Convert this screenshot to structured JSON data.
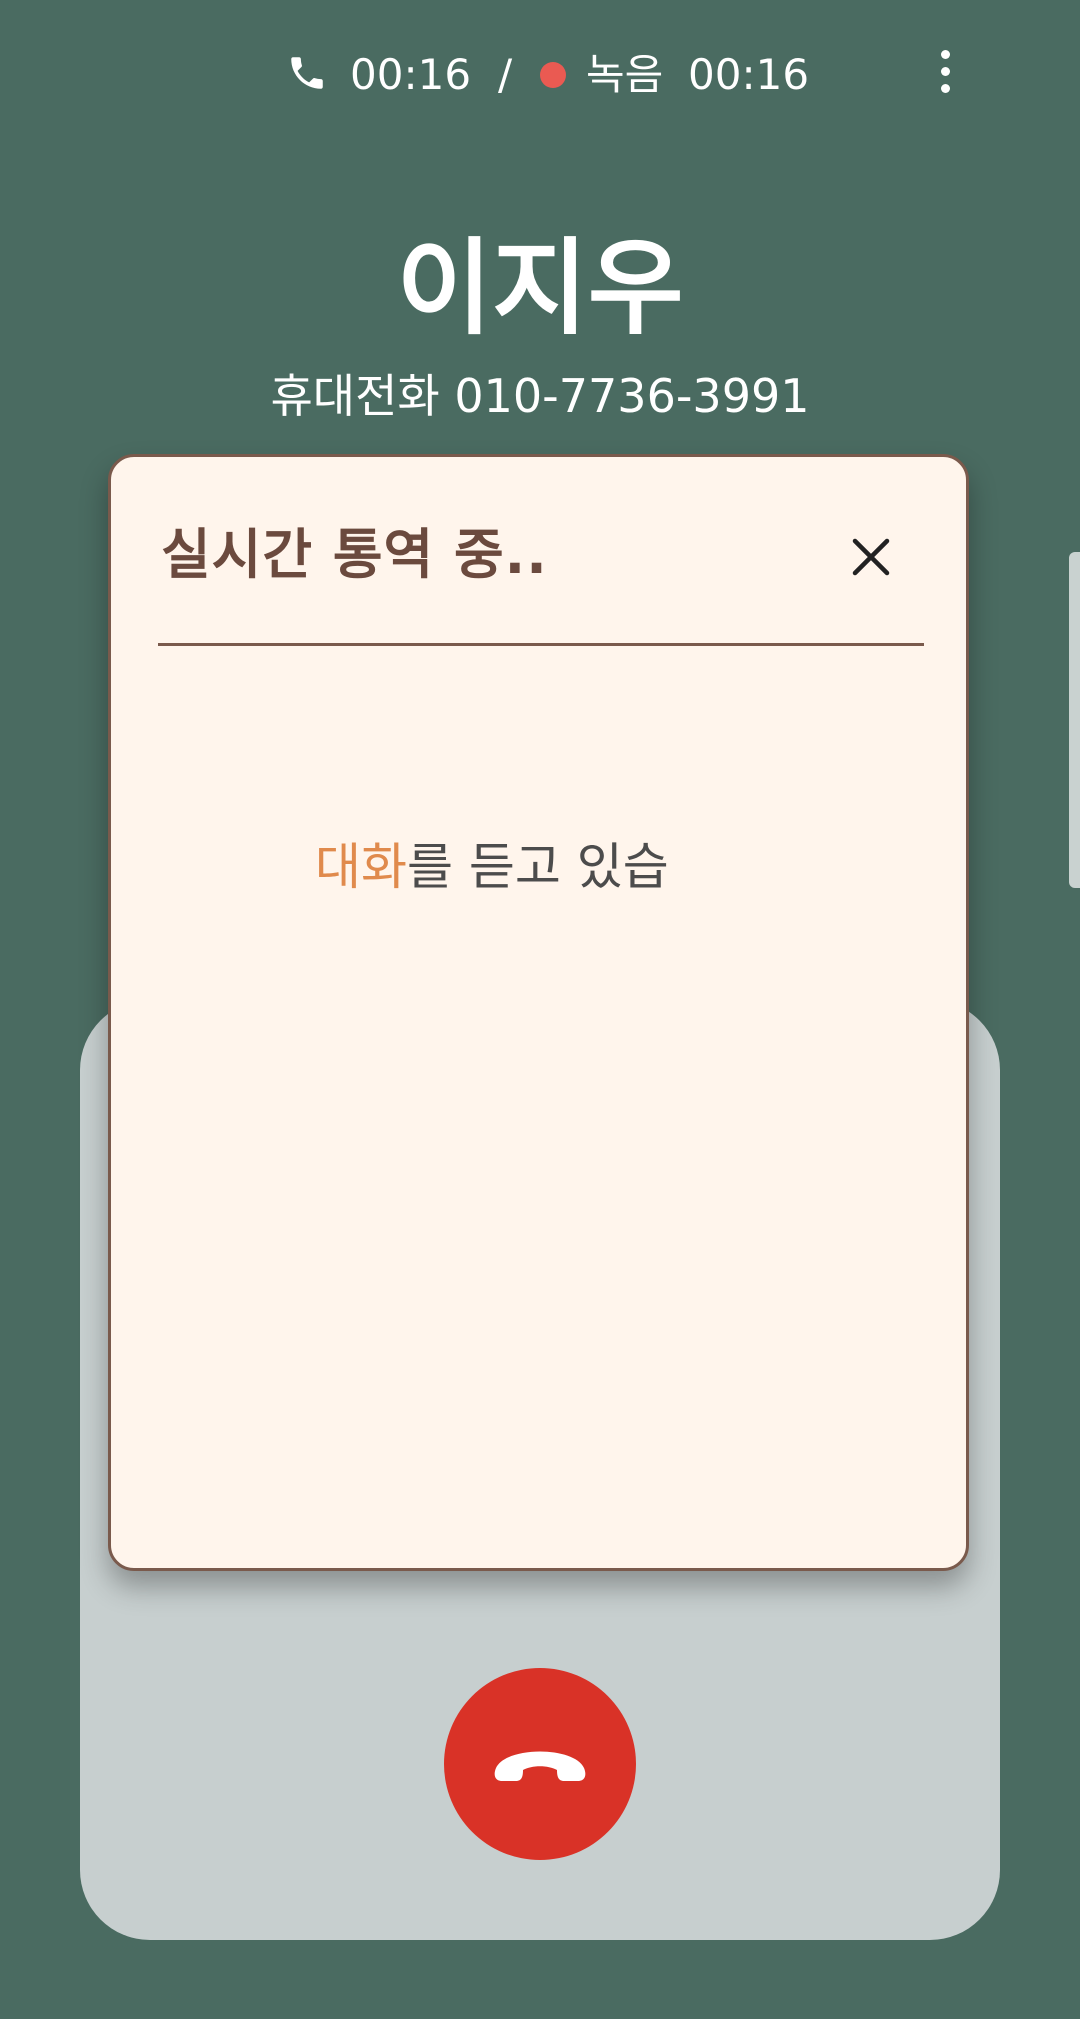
{
  "status_bar": {
    "call_time": "00:16",
    "separator": "/",
    "record_label": "녹음",
    "record_time": "00:16"
  },
  "caller": {
    "name": "이지우",
    "number": "휴대전화 010-7736-3991"
  },
  "dialog": {
    "title": "실시간 통역 중..",
    "status_highlight": "대화",
    "status_rest": "를 듣고 있습"
  },
  "colors": {
    "background": "#4a6b61",
    "dialog_bg": "#fff5ec",
    "dialog_border": "#7a5a4c",
    "accent": "#e08a4c",
    "end_call": "#d93227",
    "record_dot": "#ea5a52"
  },
  "icons": {
    "call": "phone-icon",
    "more": "more-vertical-icon",
    "close": "close-icon",
    "end_call": "end-call-icon"
  }
}
